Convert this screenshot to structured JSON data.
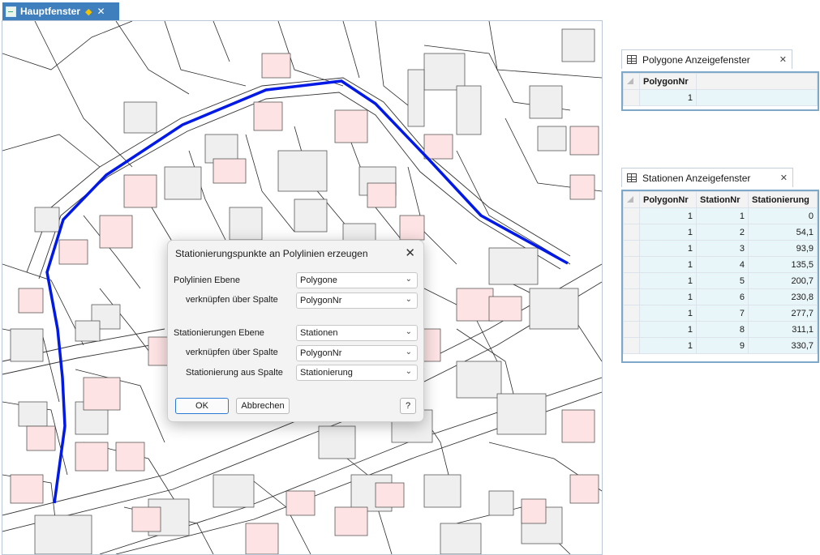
{
  "main_window": {
    "title": "Hauptfenster",
    "modified_marker": "◆",
    "close": "✕"
  },
  "dialog": {
    "title": "Stationierungspunkte an Polylinien erzeugen",
    "close": "✕",
    "polyline_layer_label": "Polylinien Ebene",
    "polyline_layer_value": "Polygone",
    "polyline_link_label": "verknüpfen über Spalte",
    "polyline_link_value": "PolygonNr",
    "station_layer_label": "Stationierungen Ebene",
    "station_layer_value": "Stationen",
    "station_link_label": "verknüpfen über Spalte",
    "station_link_value": "PolygonNr",
    "station_column_label": "Stationierung aus Spalte",
    "station_column_value": "Stationierung",
    "ok_label": "OK",
    "cancel_label": "Abbrechen",
    "help_label": "?",
    "chevron": "⌄"
  },
  "polygon_panel": {
    "title": "Polygone Anzeigefenster",
    "close": "✕",
    "columns": [
      "PolygonNr"
    ],
    "rows": [
      [
        "1"
      ]
    ]
  },
  "stations_panel": {
    "title": "Stationen Anzeigefenster",
    "close": "✕",
    "columns": [
      "PolygonNr",
      "StationNr",
      "Stationierung"
    ],
    "rows": [
      [
        "1",
        "1",
        "0"
      ],
      [
        "1",
        "2",
        "54,1"
      ],
      [
        "1",
        "3",
        "93,9"
      ],
      [
        "1",
        "4",
        "135,5"
      ],
      [
        "1",
        "5",
        "200,7"
      ],
      [
        "1",
        "6",
        "230,8"
      ],
      [
        "1",
        "7",
        "277,7"
      ],
      [
        "1",
        "8",
        "311,1"
      ],
      [
        "1",
        "9",
        "330,7"
      ]
    ]
  },
  "colors": {
    "accent": "#3f7fbd",
    "polyline": "#0019e6",
    "building_gray": "#efefef",
    "building_pink": "#fde3e3"
  }
}
